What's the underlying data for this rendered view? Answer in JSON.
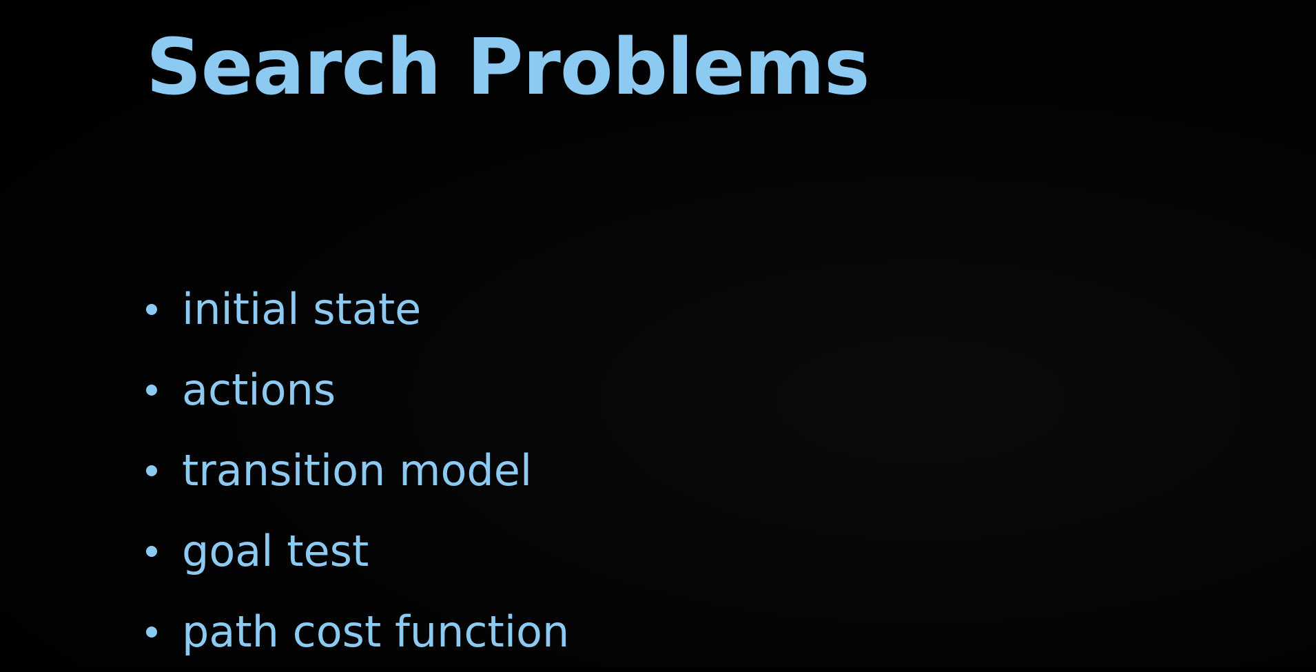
{
  "slide": {
    "title": "Search Problems",
    "bullets": [
      {
        "text": "initial state"
      },
      {
        "text": "actions"
      },
      {
        "text": "transition model"
      },
      {
        "text": "goal test"
      },
      {
        "text": "path cost function"
      }
    ]
  },
  "colors": {
    "background": "#000000",
    "accent": "#8ccaf2"
  }
}
